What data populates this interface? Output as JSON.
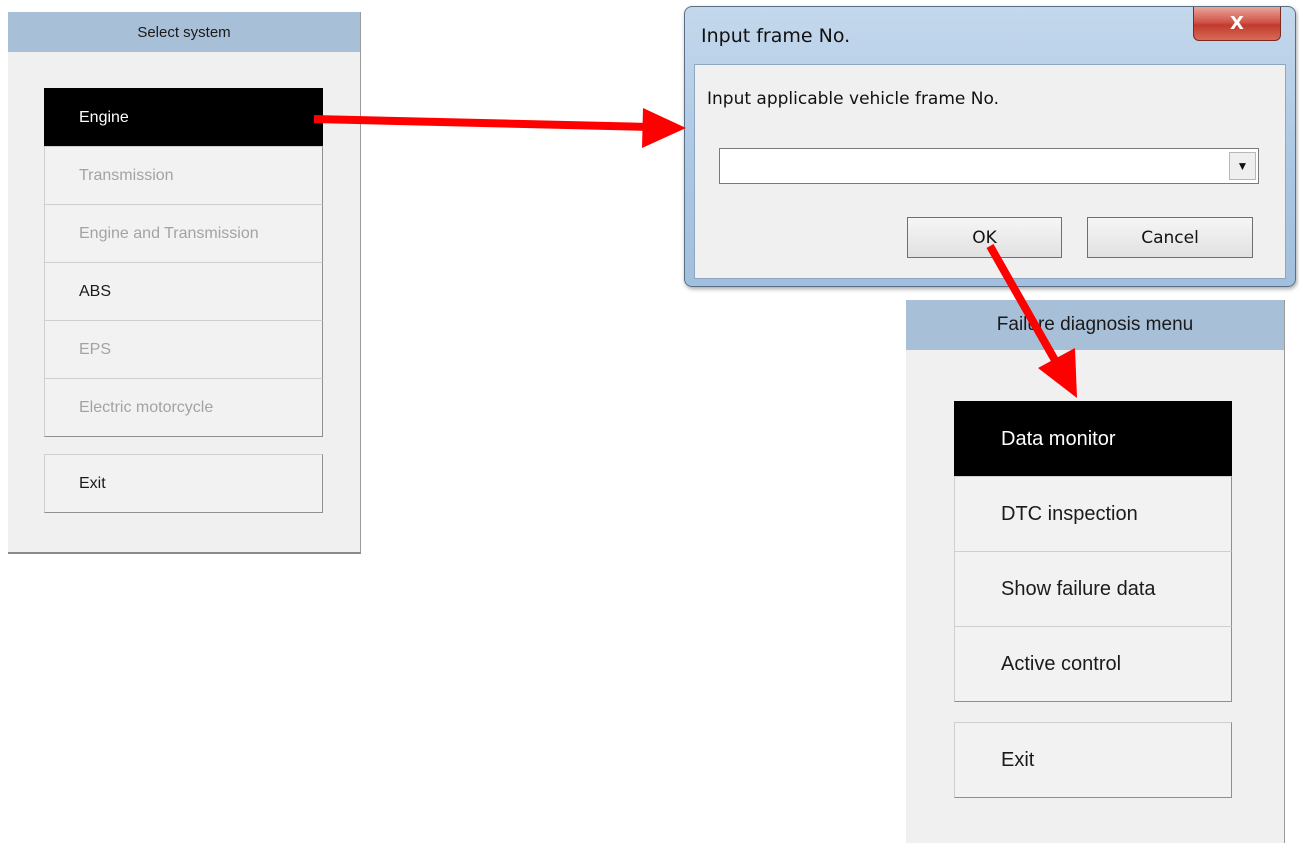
{
  "select_system": {
    "title": "Select system",
    "items": [
      {
        "label": "Engine",
        "state": "selected"
      },
      {
        "label": "Transmission",
        "state": "disabled"
      },
      {
        "label": "Engine and Transmission",
        "state": "disabled"
      },
      {
        "label": "ABS",
        "state": "enabled"
      },
      {
        "label": "EPS",
        "state": "disabled"
      },
      {
        "label": "Electric motorcycle",
        "state": "disabled"
      }
    ],
    "exit_label": "Exit"
  },
  "dialog": {
    "title": "Input frame No.",
    "close_glyph": "X",
    "prompt": "Input applicable vehicle frame No.",
    "frame_value": "",
    "dropdown_glyph": "▼",
    "ok_label": "OK",
    "cancel_label": "Cancel"
  },
  "failure_menu": {
    "title": "Failure diagnosis menu",
    "items": [
      {
        "label": "Data monitor",
        "state": "selected"
      },
      {
        "label": "DTC inspection",
        "state": "enabled"
      },
      {
        "label": "Show failure data",
        "state": "enabled"
      },
      {
        "label": "Active control",
        "state": "enabled"
      }
    ],
    "exit_label": "Exit"
  },
  "arrow_color": "#ff0000"
}
